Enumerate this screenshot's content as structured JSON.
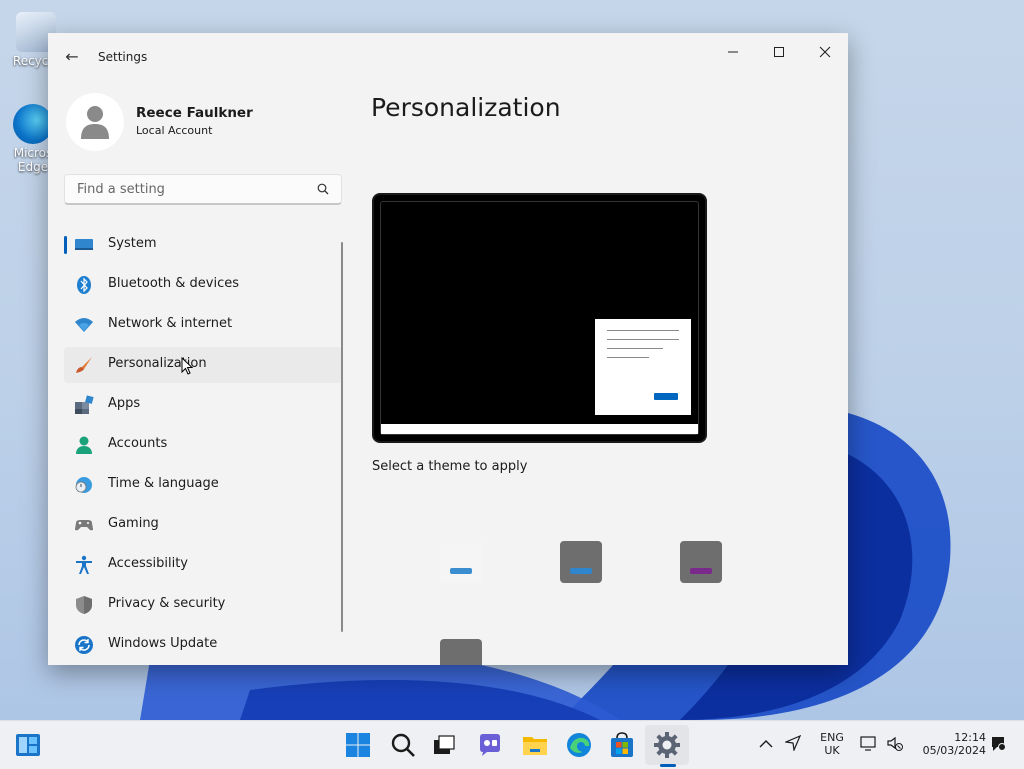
{
  "desktop": {
    "icons": [
      {
        "label": "Recycle"
      },
      {
        "label": "Micros Edge"
      }
    ]
  },
  "window": {
    "title": "Settings",
    "back_symbol": "←",
    "controls": {
      "minimize": "—",
      "maximize": "☐",
      "close": "✕"
    }
  },
  "profile": {
    "name": "Reece Faulkner",
    "account_type": "Local Account"
  },
  "search": {
    "placeholder": "Find a setting",
    "icon": "search-icon"
  },
  "nav": {
    "items": [
      {
        "label": "System",
        "icon": "system-icon",
        "selected": true
      },
      {
        "label": "Bluetooth & devices",
        "icon": "bluetooth-icon"
      },
      {
        "label": "Network & internet",
        "icon": "wifi-icon"
      },
      {
        "label": "Personalization",
        "icon": "brush-icon",
        "hovered": true
      },
      {
        "label": "Apps",
        "icon": "apps-icon"
      },
      {
        "label": "Accounts",
        "icon": "accounts-icon"
      },
      {
        "label": "Time & language",
        "icon": "globe-clock-icon"
      },
      {
        "label": "Gaming",
        "icon": "gamepad-icon"
      },
      {
        "label": "Accessibility",
        "icon": "accessibility-icon"
      },
      {
        "label": "Privacy & security",
        "icon": "shield-icon"
      },
      {
        "label": "Windows Update",
        "icon": "update-icon"
      }
    ]
  },
  "main": {
    "title": "Personalization",
    "theme_caption": "Select a theme to apply",
    "themes": [
      {
        "bg": "#f5f5f5",
        "accent": "#3a8ed0"
      },
      {
        "bg": "#6e6e6e",
        "accent": "#2f86cc"
      },
      {
        "bg": "#6e6e6e",
        "accent": "#7a2a8a"
      },
      {
        "bg": "#6e6e6e",
        "accent": "#6e6e6e"
      }
    ]
  },
  "taskbar": {
    "apps": [
      "start-icon",
      "search-icon",
      "task-view-icon",
      "chat-icon",
      "file-explorer-icon",
      "edge-icon",
      "store-icon",
      "settings-icon"
    ],
    "tray": {
      "language": "ENG",
      "region": "UK",
      "time": "12:14",
      "date": "05/03/2024"
    }
  },
  "colors": {
    "accent": "#005fb8",
    "window_bg": "#f3f3f3"
  }
}
